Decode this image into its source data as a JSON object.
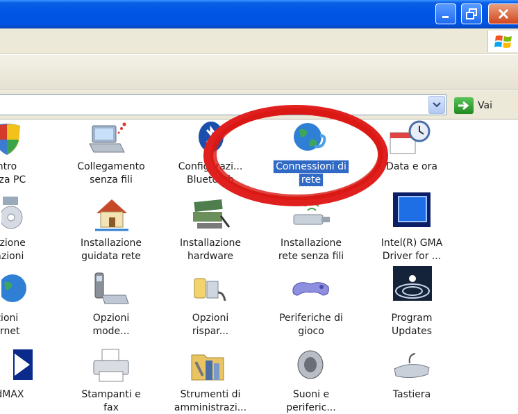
{
  "window": {
    "minimize": "minimize",
    "maximize": "maximize",
    "close": "close"
  },
  "address": {
    "go_label": "Vai"
  },
  "items": [
    {
      "label_1": "ntro",
      "label_2": "ezza PC",
      "icon": "security-shield-icon"
    },
    {
      "label_1": "Collegamento",
      "label_2": "senza fili",
      "icon": "wireless-laptop-icon"
    },
    {
      "label_1": "Configurazi...",
      "label_2": "Bluetooth",
      "icon": "bluetooth-icon"
    },
    {
      "label_1": "Connessioni di",
      "label_2": "rete",
      "icon": "network-globe-icon",
      "selected": true
    },
    {
      "label_1": "Data e ora",
      "label_2": "",
      "icon": "calendar-clock-icon"
    },
    {
      "label_1": "llazione",
      "label_2": "cazioni",
      "icon": "cd-install-icon"
    },
    {
      "label_1": "Installazione",
      "label_2": "guidata rete",
      "icon": "home-network-icon"
    },
    {
      "label_1": "Installazione",
      "label_2": "hardware",
      "icon": "hardware-install-icon"
    },
    {
      "label_1": "Installazione",
      "label_2": "rete senza fili",
      "icon": "wireless-adapter-icon"
    },
    {
      "label_1": "Intel(R) GMA",
      "label_2": "Driver for ...",
      "icon": "intel-gma-icon"
    },
    {
      "label_1": "zioni",
      "label_2": "ernet",
      "icon": "internet-options-icon"
    },
    {
      "label_1": "Opzioni",
      "label_2": "mode...",
      "icon": "modem-phone-icon"
    },
    {
      "label_1": "Opzioni",
      "label_2": "rispar...",
      "icon": "power-options-icon"
    },
    {
      "label_1": "Periferiche di",
      "label_2": "gioco",
      "icon": "gamepad-icon"
    },
    {
      "label_1": "Program",
      "label_2": "Updates",
      "icon": "program-updates-icon"
    },
    {
      "label_1": "ndMAX",
      "label_2": "",
      "icon": "sendmax-icon"
    },
    {
      "label_1": "Stampanti e",
      "label_2": "fax",
      "icon": "printer-fax-icon"
    },
    {
      "label_1": "Strumenti di",
      "label_2": "amministrazi...",
      "icon": "admin-tools-icon"
    },
    {
      "label_1": "Suoni e",
      "label_2": "periferic...",
      "icon": "speaker-icon"
    },
    {
      "label_1": "Tastiera",
      "label_2": "",
      "icon": "keyboard-icon"
    }
  ]
}
